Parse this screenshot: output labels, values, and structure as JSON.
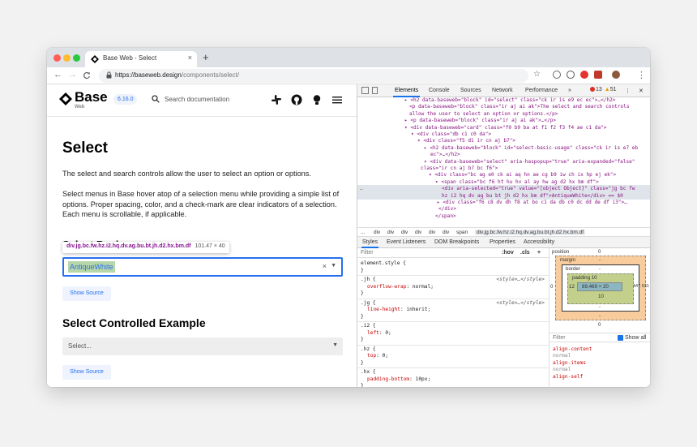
{
  "browser": {
    "tab_title": "Base Web - Select",
    "tab_close": "×",
    "new_tab": "+",
    "url_host": "https://baseweb.design",
    "url_path": "/components/select/",
    "nav_back": "←",
    "nav_forward": "→",
    "nav_reload": "C",
    "bookmark_star": "☆",
    "menu": "⋮"
  },
  "site": {
    "logo_text": "Base",
    "logo_sub": "Web",
    "version": "6.16.0",
    "search_placeholder": "Search documentation",
    "icons": [
      "slack-icon",
      "github-icon",
      "theme-bulb-icon",
      "hamburger-menu-icon"
    ]
  },
  "content": {
    "title": "Select",
    "para1": "The select and search controls allow the user to select an option or options.",
    "para2": "Select menus in Base hover atop of a selection menu while providing a simple list of options. Proper spacing, color, and a check-mark are clear indicators of a selection. Each menu is scrollable, if applicable.",
    "hidden_heading": "Select Basic",
    "tooltip_selector": "div.jg.bc.fw.hz.i2.hq.dv.ag.bu.bt.jh.d2.hx.bm.df",
    "tooltip_dims": "101.47 × 40",
    "select_value": "AntiqueWhite",
    "clear": "×",
    "caret": "▼",
    "show_source": "Show Source",
    "heading2": "Select Controlled Example",
    "select2_placeholder": "Select...",
    "show_source2": "Show Source"
  },
  "devtools": {
    "tabs": [
      "Elements",
      "Console",
      "Sources",
      "Network",
      "Performance",
      "»"
    ],
    "errors": "13",
    "warnings": "51",
    "more": "⋮",
    "close": "✕",
    "dom_lines": [
      {
        "indent": 58,
        "arrow": "▸",
        "tag": "<h2 data-baseweb=\"block\" id=\"select\" class=\"ck ir is e9 ec ec\">…</h2>"
      },
      {
        "indent": 64,
        "arrow": "",
        "tag": "<p data-baseweb=\"block\" class=\"ir aj ai ak\">The select and search controls"
      },
      {
        "indent": 64,
        "arrow": "",
        "tag": "allow the user to select an option or options.</p>"
      },
      {
        "indent": 58,
        "arrow": "▸",
        "tag": "<p data-baseweb=\"block\" class=\"ir aj ai ak\">…</p>"
      },
      {
        "indent": 58,
        "arrow": "▾",
        "tag": "<div data-baseweb=\"card\" class=\"f0 b9 ba at f1 f2 f3 f4 ae c1 da\">"
      },
      {
        "indent": 66,
        "arrow": "▾",
        "tag": "<div class=\"db c1 c0 da\">"
      },
      {
        "indent": 74,
        "arrow": "▾",
        "tag": "<div class=\"f5 d1 ir cn aj b7\">"
      },
      {
        "indent": 82,
        "arrow": "▸",
        "tag": "<h2 data-baseweb=\"block\" id=\"select-basic-usage\" class=\"ck ir is e7 eb"
      },
      {
        "indent": 90,
        "arrow": "",
        "tag": "ec\">…</h2>"
      },
      {
        "indent": 82,
        "arrow": "▾",
        "tag": "<div data-baseweb=\"select\" aria-haspopup=\"true\" aria-expanded=\"false\""
      },
      {
        "indent": 78,
        "arrow": "",
        "tag": "class=\"ir cn aj b7 bc f6\">"
      },
      {
        "indent": 88,
        "arrow": "▾",
        "tag": "<div class=\"bc ag e0 ck ai aq hn ae cg b9 iw ch ix hp ej ek\">"
      },
      {
        "indent": 96,
        "arrow": "▾",
        "tag": "<span class=\"bc f6 ht hu hv al ay hw ag d2 hx bm df\">"
      },
      {
        "indent": 104,
        "arrow": "",
        "tag": "<div aria-selected=\"true\" value=\"[object Object]\" class=\"jg bc fw",
        "selected": true
      },
      {
        "indent": 104,
        "arrow": "",
        "tag": "hz i2 hq dv ag bu bt jh d2 hx bm df\">AntiqueWhite</div> == $0",
        "selected": true
      },
      {
        "indent": 98,
        "arrow": "▸",
        "tag": "<div class=\"f6 c8 dv dh f8 at bo c1 da db c0 dc dd de df i3\">…"
      },
      {
        "indent": 100,
        "arrow": "",
        "tag": "</div>"
      },
      {
        "indent": 96,
        "arrow": "",
        "tag": "</span>"
      }
    ],
    "breadcrumbs": [
      "...",
      "div",
      "div",
      "div",
      "div",
      "div",
      "div",
      "span",
      "div.jg.bc.fw.hz.i2.hq.dv.ag.bu.bt.jh.d2.hx.bm.df"
    ],
    "sub_tabs": [
      "Styles",
      "Event Listeners",
      "DOM Breakpoints",
      "Properties",
      "Accessibility"
    ],
    "filter_placeholder": "Filter",
    "hov": ":hov",
    "cls": ".cls",
    "plus": "+",
    "rules": [
      {
        "selector": "element.style {",
        "source": "",
        "props": []
      },
      {
        "selector": ".jh {",
        "source": "<style>…</style>",
        "props": [
          {
            "k": "overflow-wrap",
            "v": "normal;"
          }
        ]
      },
      {
        "selector": ".jg {",
        "source": "<style>…</style>",
        "props": [
          {
            "k": "line-height",
            "v": "inherit;"
          }
        ]
      },
      {
        "selector": ".i2 {",
        "source": "",
        "props": [
          {
            "k": "left",
            "v": "0;"
          }
        ]
      },
      {
        "selector": ".hz {",
        "source": "",
        "props": [
          {
            "k": "top",
            "v": "0;"
          }
        ]
      },
      {
        "selector": ".hx {",
        "source": "",
        "props": [
          {
            "k": "padding-bottom",
            "v": "10px;"
          }
        ]
      }
    ],
    "box_model": {
      "position": "position",
      "position_val": "0",
      "margin": "margin",
      "margin_val": "-",
      "border": "border",
      "border_val": "-",
      "padding": "padding 10",
      "content": "89.469 × 20",
      "side_left": "12",
      "padding_bottom": "10",
      "border_bottom": "-",
      "margin_bottom": "-",
      "position_bottom": "0",
      "left_outer": "0",
      "right_outer": "447.531"
    },
    "filter2_placeholder": "Filter",
    "show_all": "Show all",
    "computed": [
      {
        "k": "align-content",
        "v": "normal"
      },
      {
        "k": "align-items",
        "v": "normal"
      },
      {
        "k": "align-self",
        "v": ""
      }
    ]
  },
  "colors": {
    "accent": "#276ef1",
    "highlight": "#b7d7a8",
    "margin_box": "#f9cc9d",
    "padding_box": "#c3d08b",
    "content_box": "#8cb6c0"
  }
}
